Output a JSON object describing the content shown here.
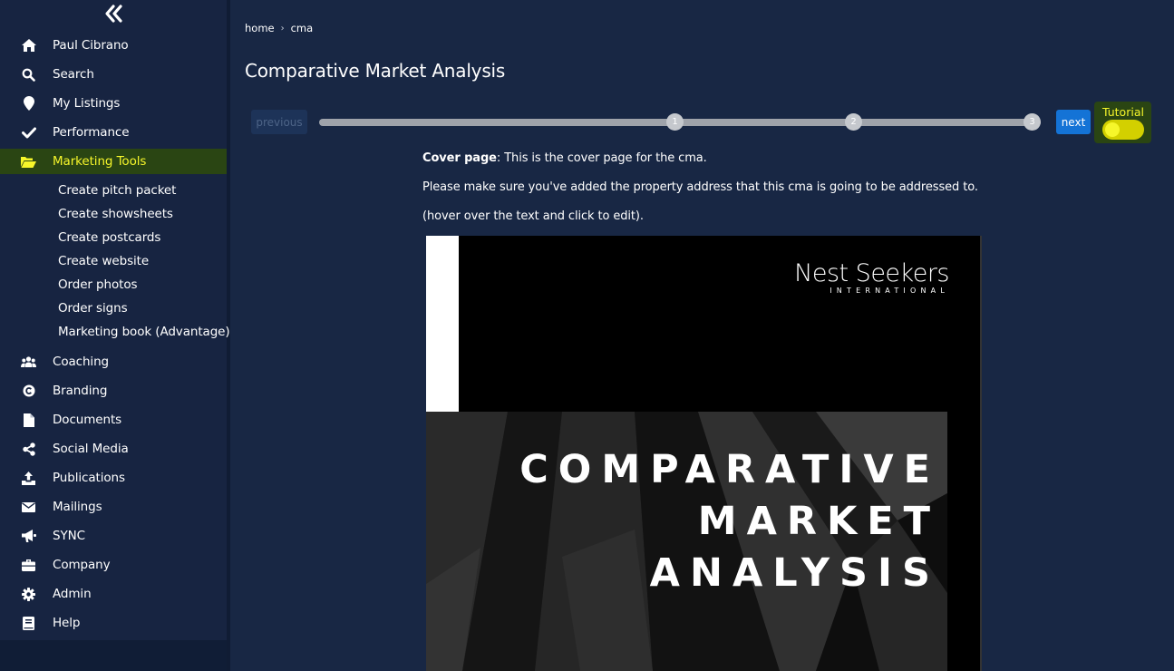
{
  "sidebar": {
    "items": [
      {
        "label": "Paul Cibrano",
        "icon": "home-icon"
      },
      {
        "label": "Search",
        "icon": "search-icon"
      },
      {
        "label": "My Listings",
        "icon": "map-pin-icon"
      },
      {
        "label": "Performance",
        "icon": "checkmark-icon"
      },
      {
        "label": "Marketing Tools",
        "icon": "folder-open-icon",
        "active": true
      },
      {
        "label": "Coaching",
        "icon": "users-icon"
      },
      {
        "label": "Branding",
        "icon": "copyright-icon"
      },
      {
        "label": "Documents",
        "icon": "document-icon"
      },
      {
        "label": "Social Media",
        "icon": "share-icon"
      },
      {
        "label": "Publications",
        "icon": "upload-icon"
      },
      {
        "label": "Mailings",
        "icon": "envelope-icon"
      },
      {
        "label": "SYNC",
        "icon": "megaphone-icon"
      },
      {
        "label": "Company",
        "icon": "briefcase-icon"
      },
      {
        "label": "Admin",
        "icon": "gear-icon"
      },
      {
        "label": "Help",
        "icon": "book-icon"
      }
    ],
    "submenu": [
      "Create pitch packet",
      "Create showsheets",
      "Create postcards",
      "Create website",
      "Order photos",
      "Order signs",
      "Marketing book (Advantage)"
    ]
  },
  "breadcrumb": {
    "home": "home",
    "separator": "›",
    "current": "cma"
  },
  "page": {
    "title": "Comparative Market Analysis"
  },
  "stepper": {
    "previous_label": "previous",
    "next_label": "next",
    "steps": [
      "1",
      "2",
      "3"
    ],
    "tutorial_label": "Tutorial",
    "tutorial_on": true
  },
  "instructions": {
    "bold_label": "Cover page",
    "line1": ": This is the cover page for the cma.",
    "line2": "Please make sure you've added the property address that this cma is going to be addressed to.",
    "line3": "(hover over the text and click to edit)."
  },
  "cover": {
    "logo_main": "Nest Seekers",
    "logo_sub": "INTERNATIONAL",
    "title_lines": [
      "COMPARATIVE",
      "MARKET",
      "ANALYSIS"
    ]
  },
  "colors": {
    "background": "#182744",
    "sidebar": "#172441",
    "highlight": "#f6f62a",
    "active_bg": "#2a4513",
    "next_button": "#1473d6"
  }
}
